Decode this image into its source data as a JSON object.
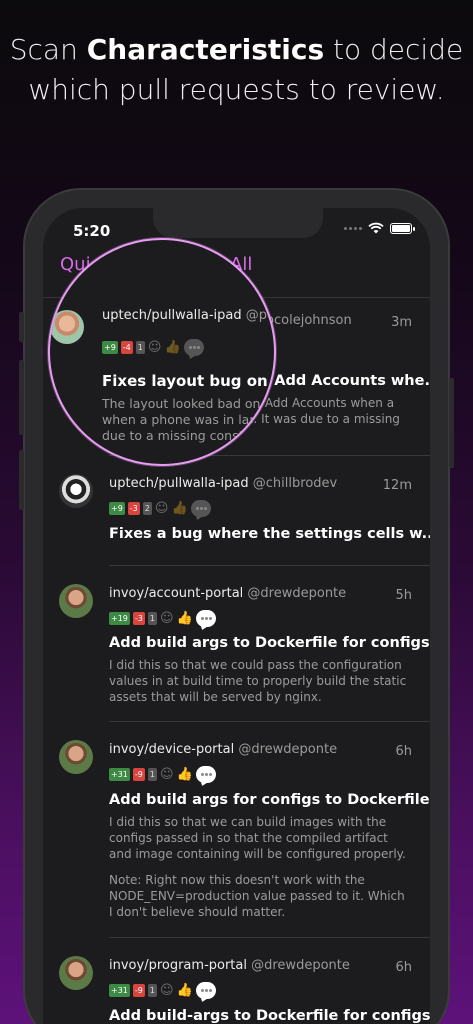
{
  "headline": {
    "pre": "Scan ",
    "highlight": "Characteristics",
    "post": " to decide which pull requests to review."
  },
  "status_bar": {
    "time": "5:20"
  },
  "nav": {
    "left": "Quick Filters",
    "right": "All"
  },
  "pull_requests": [
    {
      "repo": "uptech/pullwalla-ipad",
      "user": "@pcolejohnson",
      "time": "3m",
      "additions": "+9",
      "deletions": "-4",
      "comments": "1",
      "title": "Fixes layout bug on Add Accounts whe...",
      "body": "The layout looked bad on Add Accounts when a phone was in landscape. It was due to a missing constraint.",
      "body_visible": "The layout looked bad o      dd Accounts when a phone was in landscap       t was due to a missing constraint."
    },
    {
      "repo": "uptech/pullwalla-ipad",
      "user": "@chillbrodev",
      "time": "12m",
      "additions": "+9",
      "deletions": "-3",
      "comments": "2",
      "title": "Fixes a bug where the settings cells w...",
      "body": ""
    },
    {
      "repo": "invoy/account-portal",
      "user": "@drewdeponte",
      "time": "5h",
      "additions": "+19",
      "deletions": "-3",
      "comments": "1",
      "title": "Add build args to Dockerfile for configs",
      "body": "I did this so that we could pass the configuration values in at build time to properly build the static assets that will be served by nginx."
    },
    {
      "repo": "invoy/device-portal",
      "user": "@drewdeponte",
      "time": "6h",
      "additions": "+31",
      "deletions": "-9",
      "comments": "1",
      "title": "Add build args for configs to Dockerfile",
      "body": "I did this so that we can build images with the configs passed in so that the compiled artifact and image containing will be configured properly.",
      "note": "Note: Right now this doesn't work with the NODE_ENV=production value passed to it. Which I don't believe should matter."
    },
    {
      "repo": "invoy/program-portal",
      "user": "@drewdeponte",
      "time": "6h",
      "additions": "+31",
      "deletions": "-9",
      "comments": "1",
      "title": "Add build-args to Dockerfile for configs"
    }
  ],
  "colors": {
    "accent": "#d76be6",
    "additions": "#3d8a45",
    "deletions": "#d9453e",
    "magnifier_ring": "#e89bf2"
  },
  "icons": [
    "wifi-icon",
    "battery-icon",
    "thumbs-up-icon",
    "comment-bubble-icon",
    "smiley-icon"
  ]
}
